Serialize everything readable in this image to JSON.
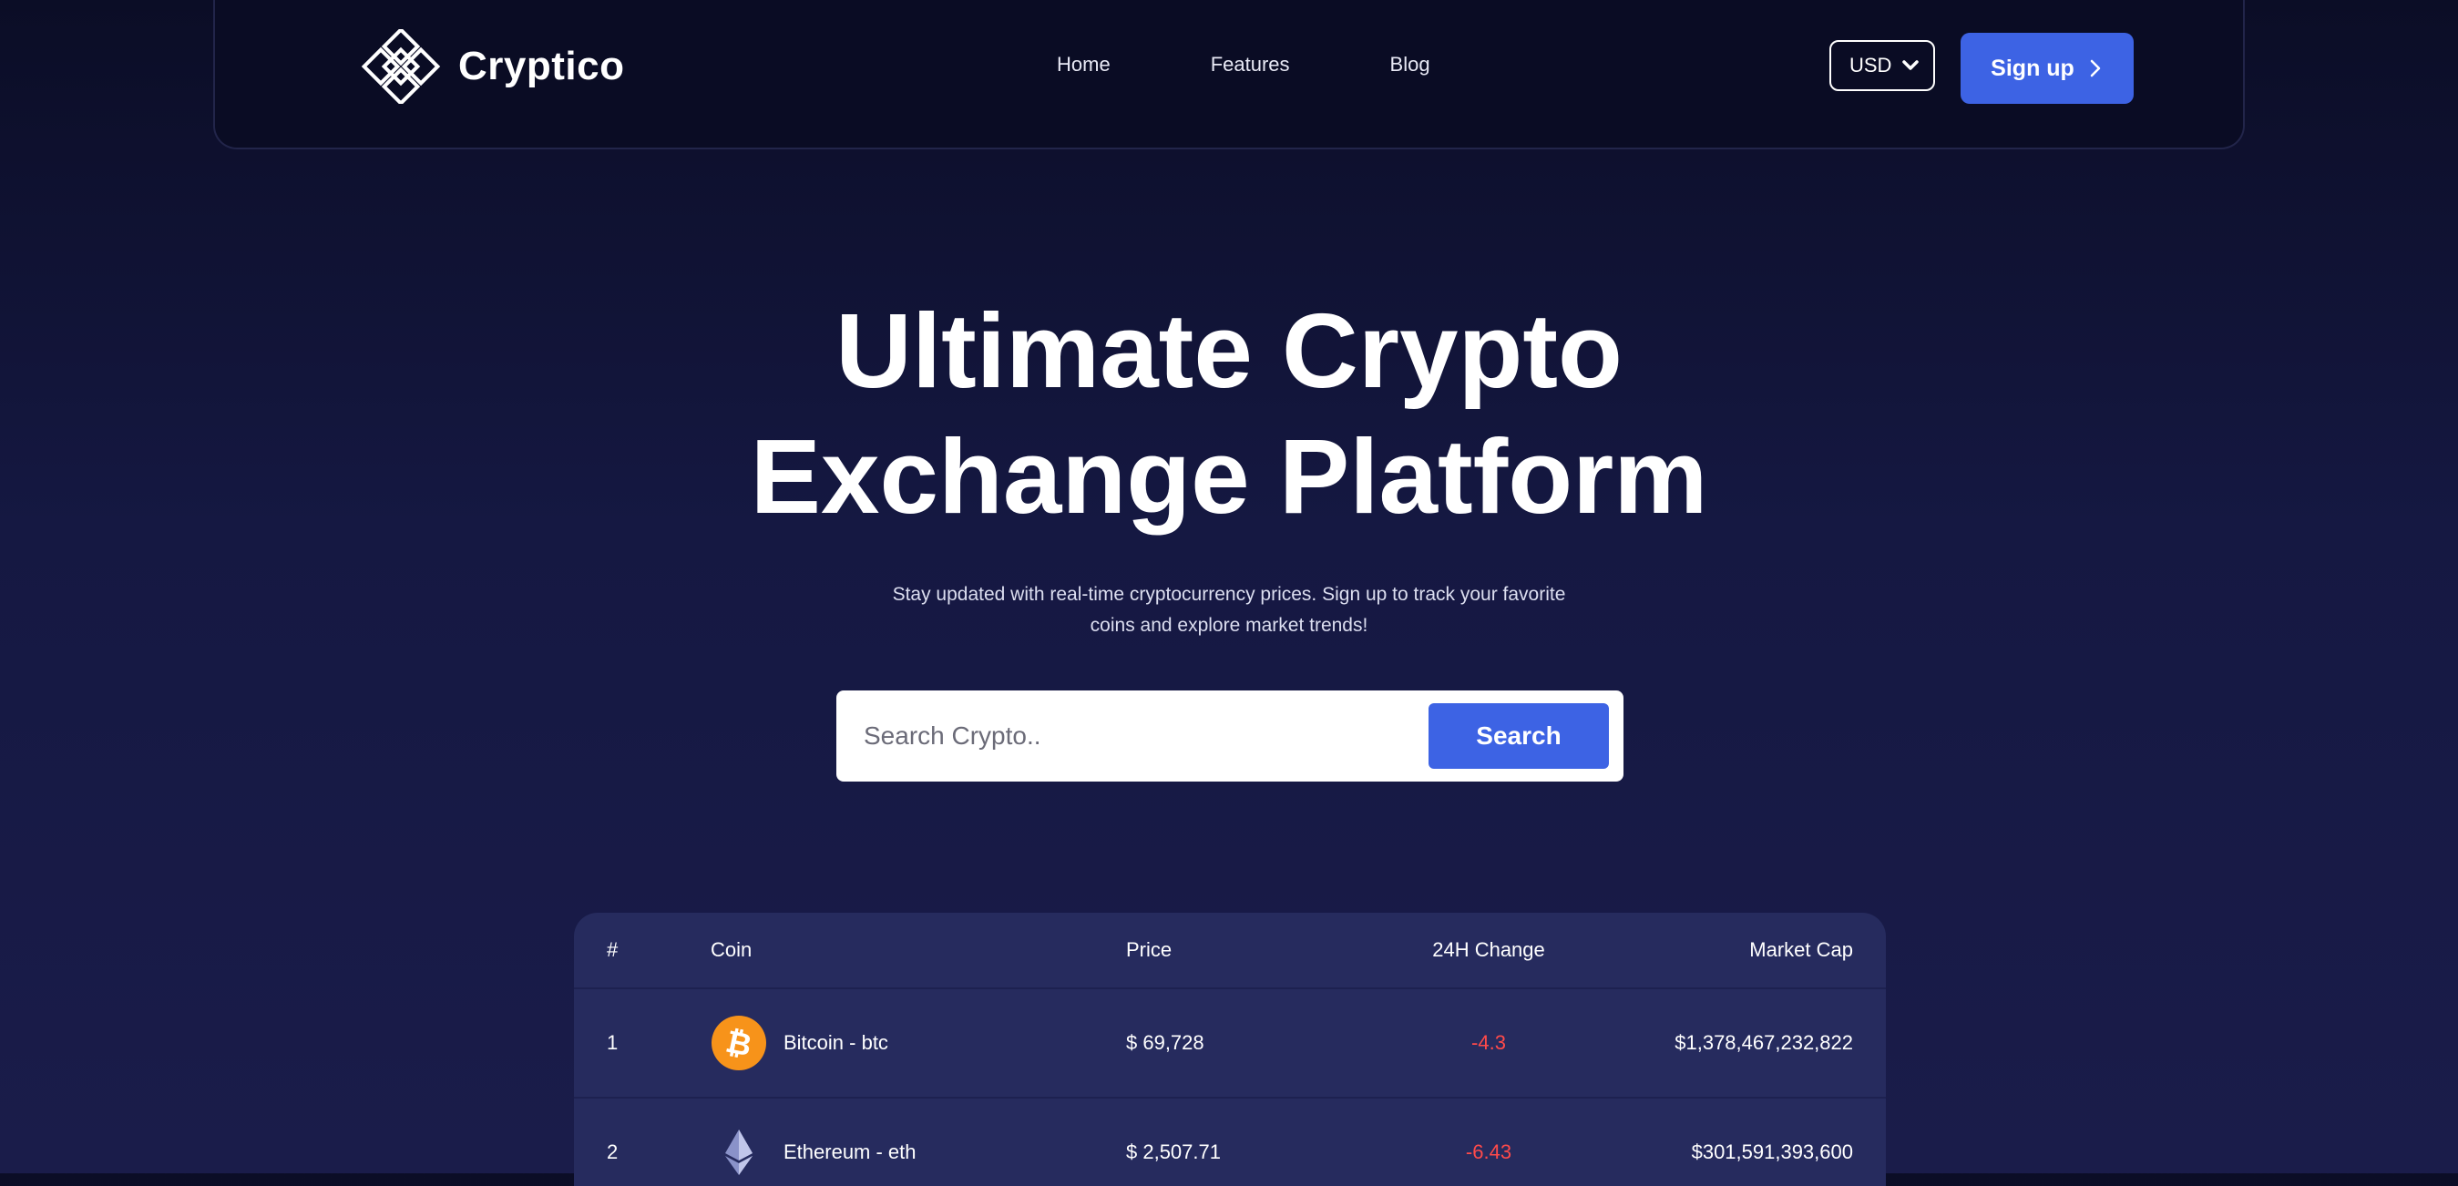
{
  "nav": {
    "brand": "Cryptico",
    "links": [
      "Home",
      "Features",
      "Blog"
    ],
    "currency": "USD",
    "signup_label": "Sign up"
  },
  "hero": {
    "title_line1": "Ultimate Crypto",
    "title_line2": "Exchange Platform",
    "subtitle_line1": "Stay updated with real-time cryptocurrency prices. Sign up to track your favorite",
    "subtitle_line2": "coins and explore market trends!"
  },
  "search": {
    "placeholder": "Search Crypto..",
    "button_label": "Search"
  },
  "table": {
    "headers": [
      "#",
      "Coin",
      "Price",
      "24H Change",
      "Market Cap"
    ],
    "rows": [
      {
        "rank": "1",
        "coin": "Bitcoin - btc",
        "price": "$ 69,728",
        "change": "-4.3",
        "market_cap": "$1,378,467,232,822",
        "icon": "bitcoin-icon"
      },
      {
        "rank": "2",
        "coin": "Ethereum - eth",
        "price": "$ 2,507.71",
        "change": "-6.43",
        "market_cap": "$301,591,393,600",
        "icon": "ethereum-icon"
      }
    ]
  },
  "colors": {
    "accent": "#3d63e4",
    "negative": "#ff4a4a",
    "bitcoin": "#f7931a",
    "table_bg": "#262b5e"
  }
}
